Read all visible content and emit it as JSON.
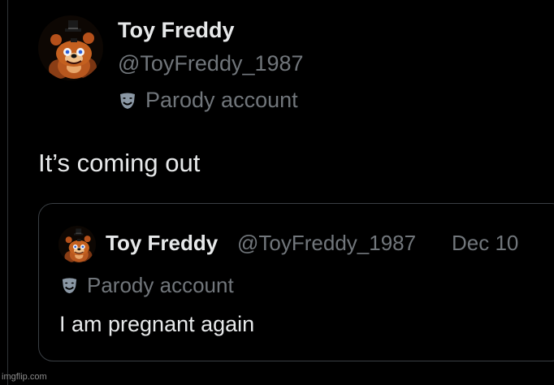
{
  "tweet": {
    "author": {
      "display_name": "Toy Freddy",
      "handle": "@ToyFreddy_1987",
      "label_icon": "parody-mask-icon",
      "label": "Parody account"
    },
    "text": "It’s coming out",
    "quoted_post": {
      "author": {
        "display_name": "Toy Freddy",
        "handle": "@ToyFreddy_1987",
        "label_icon": "parody-mask-icon",
        "label": "Parody account"
      },
      "date": "Dec 10",
      "text": "I am pregnant again"
    }
  },
  "watermark": "imgflip.com",
  "colors": {
    "background": "#000000",
    "primary_text": "#e7e9ea",
    "secondary_text": "#71767b",
    "border": "#3a3f44"
  }
}
